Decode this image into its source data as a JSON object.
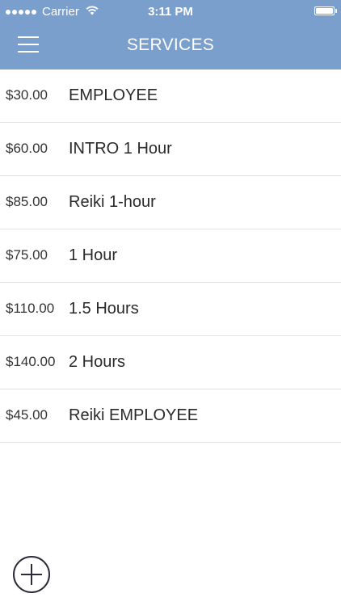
{
  "status_bar": {
    "carrier": "Carrier",
    "time": "3:11 PM"
  },
  "header": {
    "title": "SERVICES"
  },
  "services": [
    {
      "price": "$30.00",
      "name": "EMPLOYEE"
    },
    {
      "price": "$60.00",
      "name": "INTRO 1 Hour"
    },
    {
      "price": "$85.00",
      "name": "Reiki 1-hour"
    },
    {
      "price": "$75.00",
      "name": "1 Hour"
    },
    {
      "price": "$110.00",
      "name": "1.5 Hours"
    },
    {
      "price": "$140.00",
      "name": "2 Hours"
    },
    {
      "price": "$45.00",
      "name": "Reiki EMPLOYEE"
    }
  ],
  "colors": {
    "header_background": "#7b9fcc",
    "divider": "#e3e3e3"
  },
  "icons": {
    "menu": "hamburger-menu-icon",
    "add": "plus-circle-icon",
    "wifi": "wifi-icon",
    "battery": "battery-icon"
  }
}
